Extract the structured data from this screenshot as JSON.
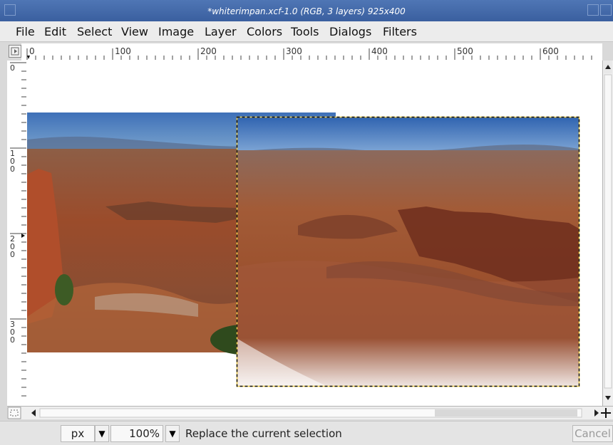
{
  "window": {
    "title": "*whiterimpan.xcf-1.0 (RGB, 3 layers) 925x400"
  },
  "menu": [
    {
      "label": "File"
    },
    {
      "label": "Edit"
    },
    {
      "label": "Select"
    },
    {
      "label": "View"
    },
    {
      "label": "Image"
    },
    {
      "label": "Layer"
    },
    {
      "label": "Colors"
    },
    {
      "label": "Tools"
    },
    {
      "label": "Dialogs"
    },
    {
      "label": "Filters"
    }
  ],
  "ruler": {
    "horizontal_labels": [
      "0",
      "100",
      "200",
      "300",
      "400",
      "500",
      "600"
    ],
    "vertical_labels": [
      "0",
      "1\n0\n0",
      "2\n0\n0",
      "3\n0\n0"
    ]
  },
  "status": {
    "unit": "px",
    "zoom": "100%",
    "message": "Replace the current selection",
    "cancel_label": "Cancel"
  },
  "colors": {
    "titlebar": "#3f65a7",
    "sky": "#4d7fbf",
    "canyon": "#9e5a34",
    "selection": "#f3d14a"
  }
}
